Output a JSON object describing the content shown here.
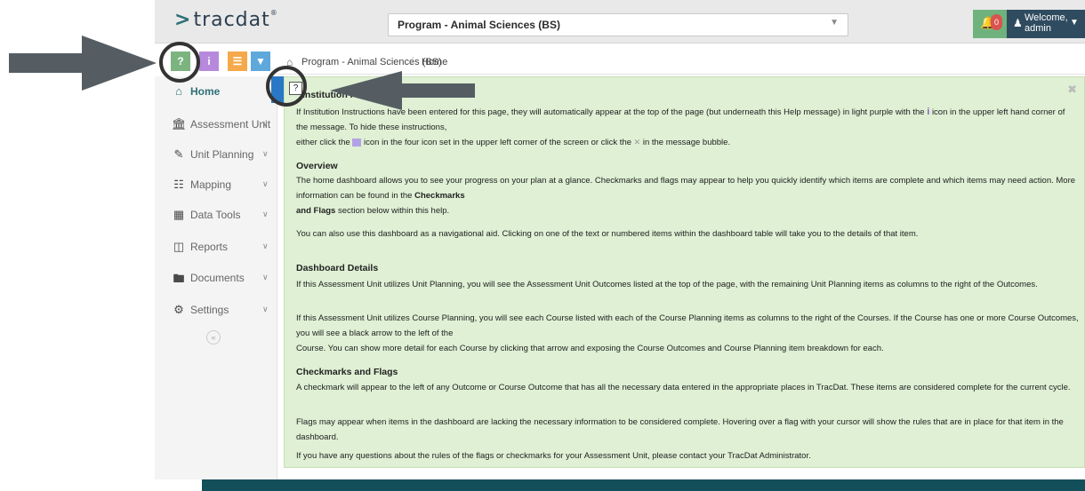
{
  "header": {
    "logo_text": "tracdat",
    "program_select": "Program - Animal Sciences (BS)",
    "notification_count": "0",
    "welcome_line1": "Welcome,",
    "welcome_line2": "admin"
  },
  "toolbar": {
    "help_label": "?",
    "instructions_label": "i"
  },
  "sidebar": {
    "items": [
      {
        "label": "Home"
      },
      {
        "label": "Assessment Unit"
      },
      {
        "label": "Unit Planning"
      },
      {
        "label": "Mapping"
      },
      {
        "label": "Data Tools"
      },
      {
        "label": "Reports"
      },
      {
        "label": "Documents"
      },
      {
        "label": "Settings"
      }
    ]
  },
  "breadcrumb": {
    "program": "Program - Animal Sciences (BS)",
    "current": "Home"
  },
  "help": {
    "title": "Institution I",
    "p1a": "If Institution Instructions have been entered for this page, they will automatically appear at the top of the page (but underneath this Help message) in light purple with the",
    "p1b": "icon in the upper left hand corner of the message. To hide these instructions,",
    "p1c": "either click the",
    "p1d": "icon in the four icon set in the upper left corner of the screen or click the",
    "p1e": "in the message bubble.",
    "overview_heading": "Overview",
    "overview_a": "The home dashboard allows you to see your progress on your plan at a glance. Checkmarks and flags may appear to help you quickly identify which items are complete and which items may need action. More information can be found in the",
    "overview_b": "Checkmarks",
    "overview_c": "and Flags",
    "overview_d": "section below within this help.",
    "nav_aid": "You can also use this dashboard as a navigational aid. Clicking on one of the text or numbered items within the dashboard table will take you to the details of that item.",
    "details_heading": "Dashboard Details",
    "details_p1": "If this Assessment Unit utilizes Unit Planning, you will see the Assessment Unit Outcomes listed at the top of the page, with the remaining Unit Planning items as columns to the right of the Outcomes.",
    "details_p2a": "If this Assessment Unit utilizes Course Planning, you will see each Course listed with each of the Course Planning items as columns to the right of the Courses. If the Course has one or more Course Outcomes, you will see a black arrow to the left of the",
    "details_p2b": "Course. You can show more detail for each Course by clicking that arrow and exposing the Course Outcomes and Course Planning item breakdown for each.",
    "flags_heading": "Checkmarks and Flags",
    "flags_p1": "A checkmark will appear to the left of any Outcome or Course Outcome that has all the necessary data entered in the appropriate places in TracDat. These items are considered complete for the current cycle.",
    "flags_p2": "Flags may appear when items in the dashboard are lacking the necessary information to be considered complete. Hovering over a flag with your cursor will show the rules that are in place for that item in the dashboard.",
    "flags_p3": "If you have any questions about the rules of the flags or checkmarks for your Assessment Unit, please contact your TracDat Administrator."
  },
  "colors": {
    "accent": "#2e6f77",
    "help_bg": "#dff0d4",
    "tb_help": "#7bb47f",
    "tb_instructions": "#b789dc",
    "tb_list": "#f5a94a",
    "tb_filter": "#5ea8dc",
    "badge": "#d9534f",
    "welcome_bg": "#2f4b5f"
  },
  "icons": {
    "home": "home-icon",
    "assessment_unit": "institution-icon",
    "unit_planning": "pencil-icon",
    "mapping": "sitemap-icon",
    "data_tools": "table-icon",
    "reports": "columns-icon",
    "documents": "folder-icon",
    "settings": "gear-icon"
  }
}
